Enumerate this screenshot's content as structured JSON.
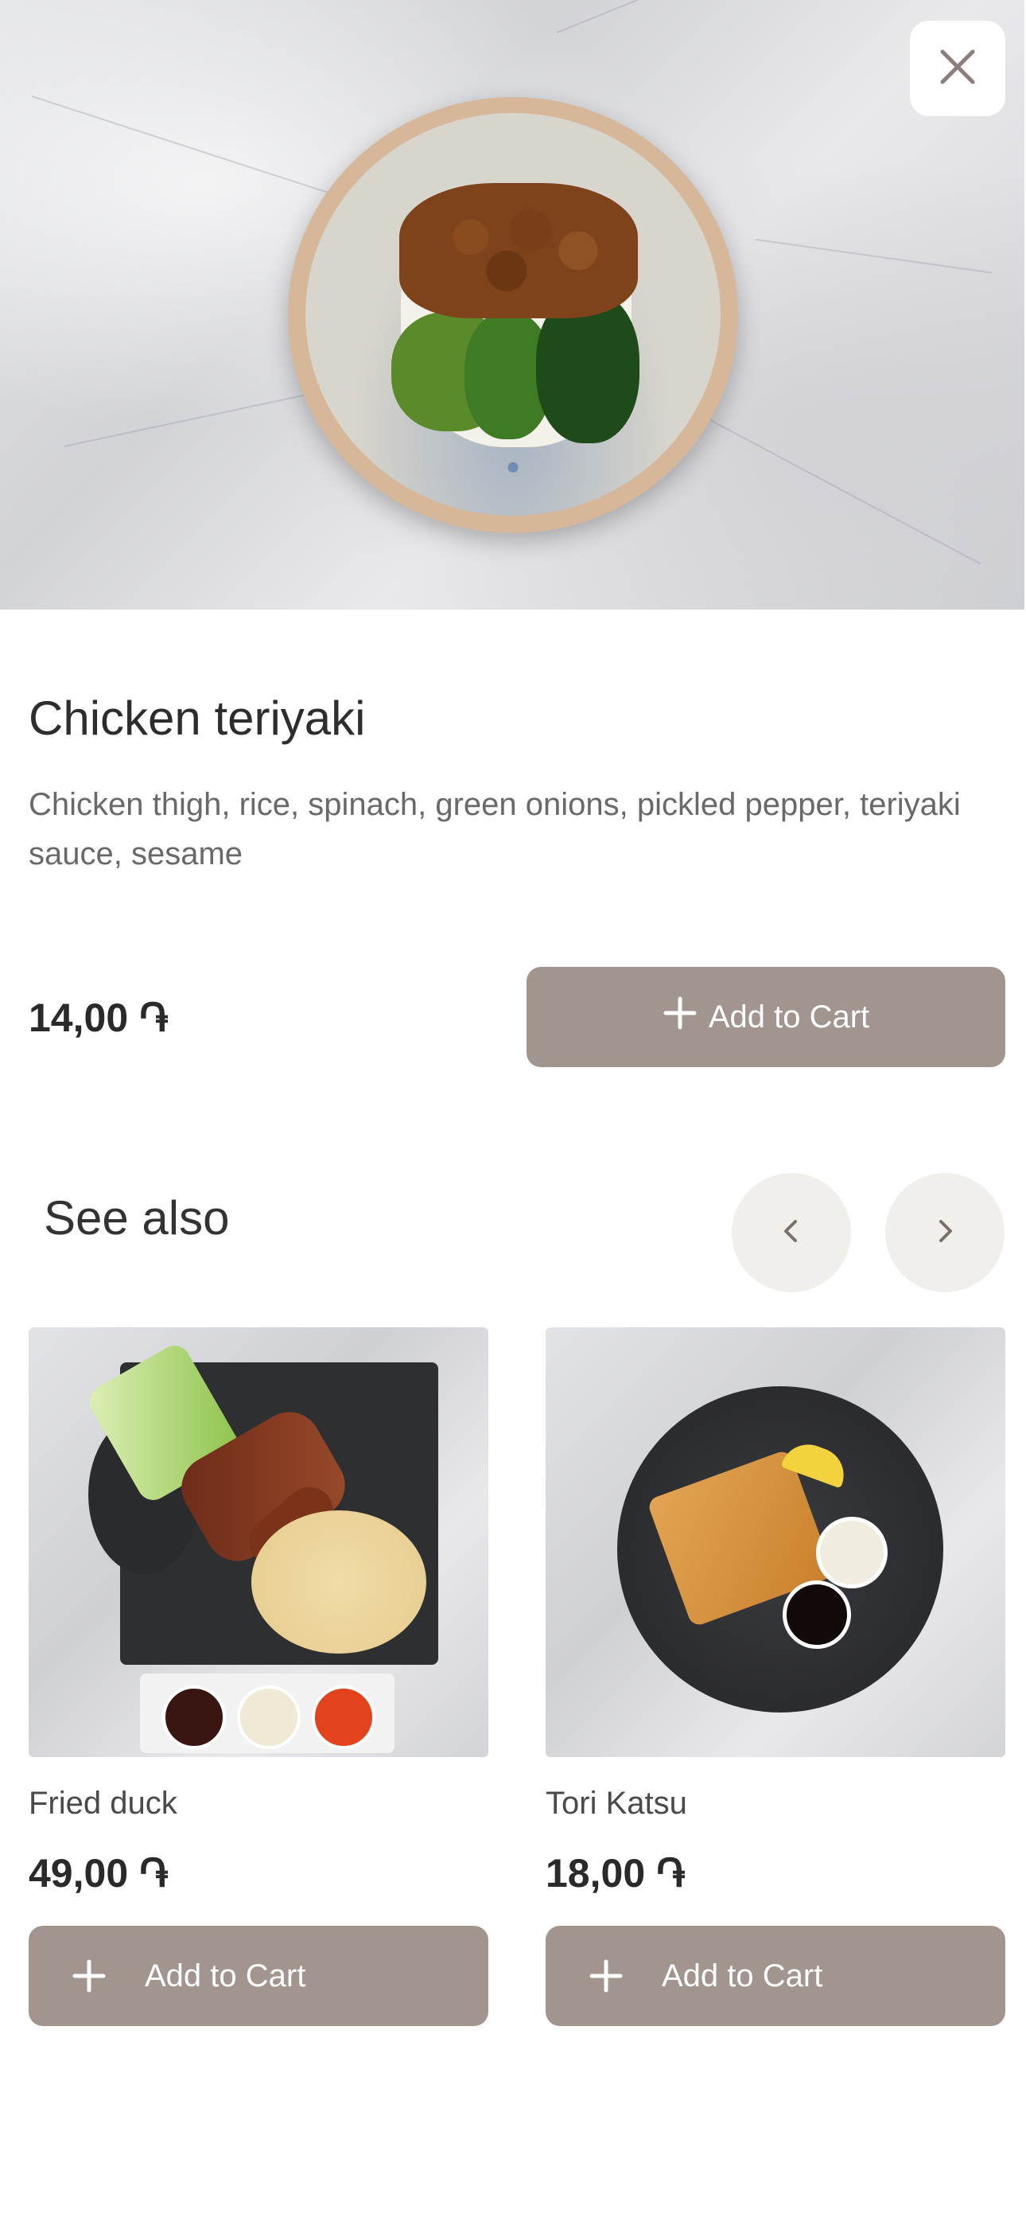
{
  "product": {
    "name": "Chicken teriyaki",
    "description": "Chicken thigh, rice, spinach, green onions, pickled pepper, teriyaki sauce, sesame",
    "price": "14,00",
    "currency_symbol": "֏",
    "add_to_cart_label": "Add to Cart"
  },
  "see_also": {
    "title": "See also",
    "items": [
      {
        "name": "Fried duck",
        "price": "49,00",
        "currency_symbol": "֏",
        "add_label": "Add to Cart"
      },
      {
        "name": "Tori Katsu",
        "price": "18,00",
        "currency_symbol": "֏",
        "add_label": "Add to Cart"
      }
    ]
  },
  "icons": {
    "close": "close-icon",
    "plus": "plus-icon",
    "prev": "chevron-left-icon",
    "next": "chevron-right-icon"
  },
  "colors": {
    "button": "#a2948e",
    "nav_button": "#f0efeb",
    "text_dark": "#2d2d2d",
    "text_muted": "#6b6868"
  }
}
